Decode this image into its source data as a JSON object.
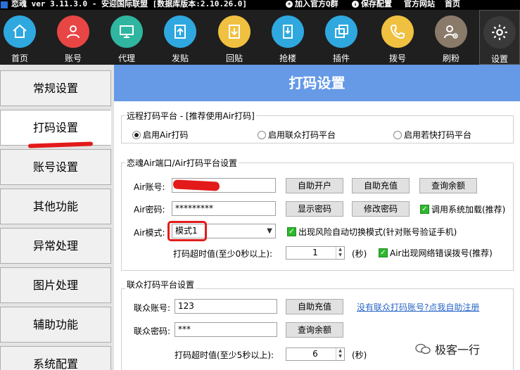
{
  "titlebar": {
    "title": "恋魂 ver 3.11.3.0 - 安迎国际联盟 [数据库版本:2.10.26.0]",
    "links": [
      "加入官方Q群",
      "保存配置",
      "官方网站",
      "首页"
    ]
  },
  "toolbar": {
    "items": [
      {
        "label": "首页",
        "icon": "home-icon",
        "color": "#2fa8e0"
      },
      {
        "label": "账号",
        "icon": "user-icon",
        "color": "#e84545"
      },
      {
        "label": "代理",
        "icon": "monitor-icon",
        "color": "#2fb5a0"
      },
      {
        "label": "发贴",
        "icon": "upload-icon",
        "color": "#2fa8e0"
      },
      {
        "label": "回贴",
        "icon": "download-icon",
        "color": "#f0c040"
      },
      {
        "label": "抢楼",
        "icon": "building-icon",
        "color": "#2fa8e0"
      },
      {
        "label": "插件",
        "icon": "plugin-icon",
        "color": "#2fa8e0"
      },
      {
        "label": "拨号",
        "icon": "phone-icon",
        "color": "#f0c040"
      },
      {
        "label": "刷粉",
        "icon": "add-user-icon",
        "color": "#8a7a6a"
      },
      {
        "label": "设置",
        "icon": "gear-icon",
        "color": "#3a3a3a"
      }
    ]
  },
  "nav": {
    "items": [
      "常规设置",
      "打码设置",
      "账号设置",
      "其他功能",
      "异常处理",
      "图片处理",
      "辅助功能",
      "系统配置"
    ],
    "selected": "打码设置"
  },
  "main": {
    "header": "打码设置",
    "remote": {
      "legend": "远程打码平台 - [推荐使用Air打码]",
      "options": [
        "启用Air打码",
        "启用联众打码平台",
        "启用若快打码平台"
      ],
      "selected": "启用Air打码"
    },
    "air": {
      "legend": "恋魂Air端口/Air打码平台设置",
      "account_label": "Air账号:",
      "account_value": "",
      "password_label": "Air密码:",
      "password_value": "*********",
      "mode_label": "Air模式:",
      "mode_value": "模式1",
      "timeout_label": "打码超时值(至少0秒以上):",
      "timeout_value": "1",
      "timeout_unit": "(秒)",
      "btn_open": "自助开户",
      "btn_recharge": "自助充值",
      "btn_balance": "查询余额",
      "btn_show_pwd": "显示密码",
      "btn_change_pwd": "修改密码",
      "chk_system_load": "调用系统加载(推荐)",
      "chk_auto_switch": "出现风险自动切换模式(针对账号验证手机)",
      "chk_redial": "Air出现网络错误拨号(推荐)"
    },
    "lianzhong": {
      "legend": "联众打码平台设置",
      "account_label": "联众账号:",
      "account_value": "123",
      "password_label": "联众密码:",
      "password_value": "***",
      "btn_recharge": "自助充值",
      "btn_balance": "查询余额",
      "register_link": "没有联众打码账号?点我自助注册",
      "timeout_label": "打码超时值(至少5秒以上):",
      "timeout_value": "6",
      "timeout_unit": "(秒)"
    }
  },
  "watermark": "极客一行",
  "colors": {
    "header_bg": "#6699e6",
    "toolbar_bg": "#1f1f1f",
    "annotation_red": "#e21a1a",
    "check_green": "#2eb82e",
    "link_blue": "#2a66c8"
  }
}
